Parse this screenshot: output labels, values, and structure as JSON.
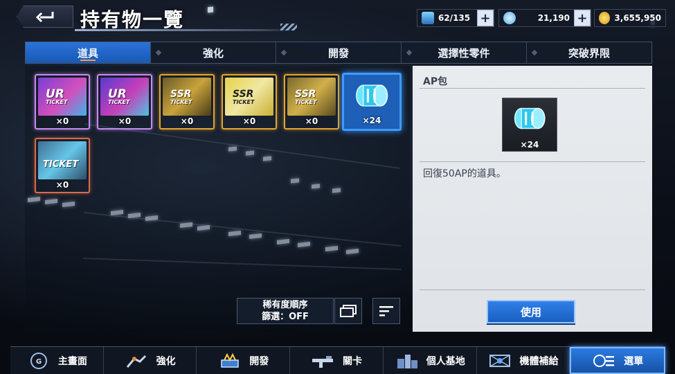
{
  "header": {
    "title": "持有物一覽",
    "resources": {
      "capacity": "62/135",
      "gems": "21,190",
      "coins": "3,655,950"
    }
  },
  "tabs": [
    {
      "label": "道具",
      "active": true
    },
    {
      "label": "強化",
      "active": false
    },
    {
      "label": "開發",
      "active": false
    },
    {
      "label": "選擇性零件",
      "active": false
    },
    {
      "label": "突破界限",
      "active": false
    }
  ],
  "items": [
    {
      "rarity": "ur",
      "text": "UR",
      "sub": "TICKET",
      "count": "×0"
    },
    {
      "rarity": "ur",
      "text": "UR",
      "sub": "TICKET",
      "count": "×0"
    },
    {
      "rarity": "ssr",
      "text": "SSR",
      "sub": "TICKET",
      "count": "×0"
    },
    {
      "rarity": "ssr",
      "text": "SSR",
      "sub": "TICKET",
      "count": "×0"
    },
    {
      "rarity": "ssr",
      "text": "SSR",
      "sub": "TICKET",
      "count": "×0"
    },
    {
      "rarity": "ap",
      "text": "",
      "sub": "",
      "count": "×24"
    },
    {
      "rarity": "sr",
      "text": "TICKET",
      "sub": "",
      "count": "×0"
    }
  ],
  "sort": {
    "line1": "稀有度順序",
    "line2": "篩選：OFF"
  },
  "detail": {
    "name": "AP包",
    "count": "×24",
    "description": "回復50AP的道具。",
    "use_label": "使用"
  },
  "bottom_nav": [
    {
      "label": "主畫面",
      "icon": "home-emblem-icon"
    },
    {
      "label": "強化",
      "icon": "robot-arm-icon"
    },
    {
      "label": "開發",
      "icon": "development-icon"
    },
    {
      "label": "關卡",
      "icon": "rifle-icon"
    },
    {
      "label": "個人基地",
      "icon": "base-icon"
    },
    {
      "label": "機體補給",
      "icon": "supply-icon"
    },
    {
      "label": "選單",
      "icon": "menu-icon"
    }
  ],
  "colors": {
    "accent": "#1f6fd6",
    "ur": "#c68cf0",
    "ssr": "#e6a62a",
    "sr": "#d86b4e"
  }
}
